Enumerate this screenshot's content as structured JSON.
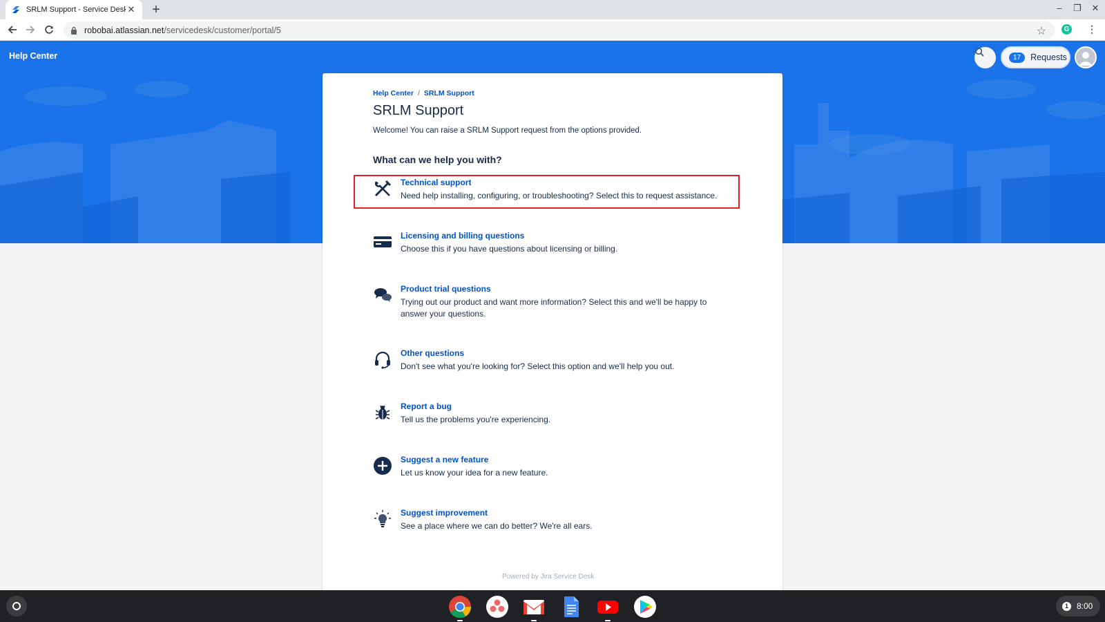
{
  "browser": {
    "tab_title": "SRLM Support - Service Desk",
    "new_tab_symbol": "+",
    "url_host": "robobai.atlassian.net",
    "url_path": "/servicedesk/customer/portal/5",
    "window_controls": [
      "–",
      "❐",
      "✕"
    ]
  },
  "header": {
    "help_center": "Help Center",
    "requests_count": "17",
    "requests_label": "Requests"
  },
  "portal": {
    "breadcrumb": [
      "Help Center",
      "SRLM Support"
    ],
    "breadcrumb_separator": "/",
    "title": "SRLM Support",
    "welcome": "Welcome! You can raise a SRLM Support request from the options provided.",
    "help_heading": "What can we help you with?",
    "request_types": [
      {
        "name": "Technical support",
        "description": "Need help installing, configuring, or troubleshooting? Select this to request assistance.",
        "icon": "tools-icon"
      },
      {
        "name": "Licensing and billing questions",
        "description": "Choose this if you have questions about licensing or billing.",
        "icon": "credit-card-icon"
      },
      {
        "name": "Product trial questions",
        "description": "Trying out our product and want more information? Select this and we'll be happy to answer your questions.",
        "icon": "chat-bubbles-icon"
      },
      {
        "name": "Other questions",
        "description": "Don't see what you're looking for? Select this option and we'll help you out.",
        "icon": "headset-icon"
      },
      {
        "name": "Report a bug",
        "description": "Tell us the problems you're experiencing.",
        "icon": "bug-icon"
      },
      {
        "name": "Suggest a new feature",
        "description": "Let us know your idea for a new feature.",
        "icon": "plus-circle-icon"
      },
      {
        "name": "Suggest improvement",
        "description": "See a place where we can do better? We're all ears.",
        "icon": "lightbulb-icon"
      }
    ],
    "footer": "Powered by Jira Service Desk"
  },
  "shelf": {
    "apps": [
      "chrome-icon",
      "asana-icon",
      "gmail-icon",
      "docs-icon",
      "youtube-icon",
      "play-store-icon"
    ],
    "notification_count": "1",
    "time": "8:00"
  },
  "colors": {
    "banner_blue": "#1a73e8",
    "link_blue": "#0052cc",
    "highlight_red": "#e01e26"
  }
}
